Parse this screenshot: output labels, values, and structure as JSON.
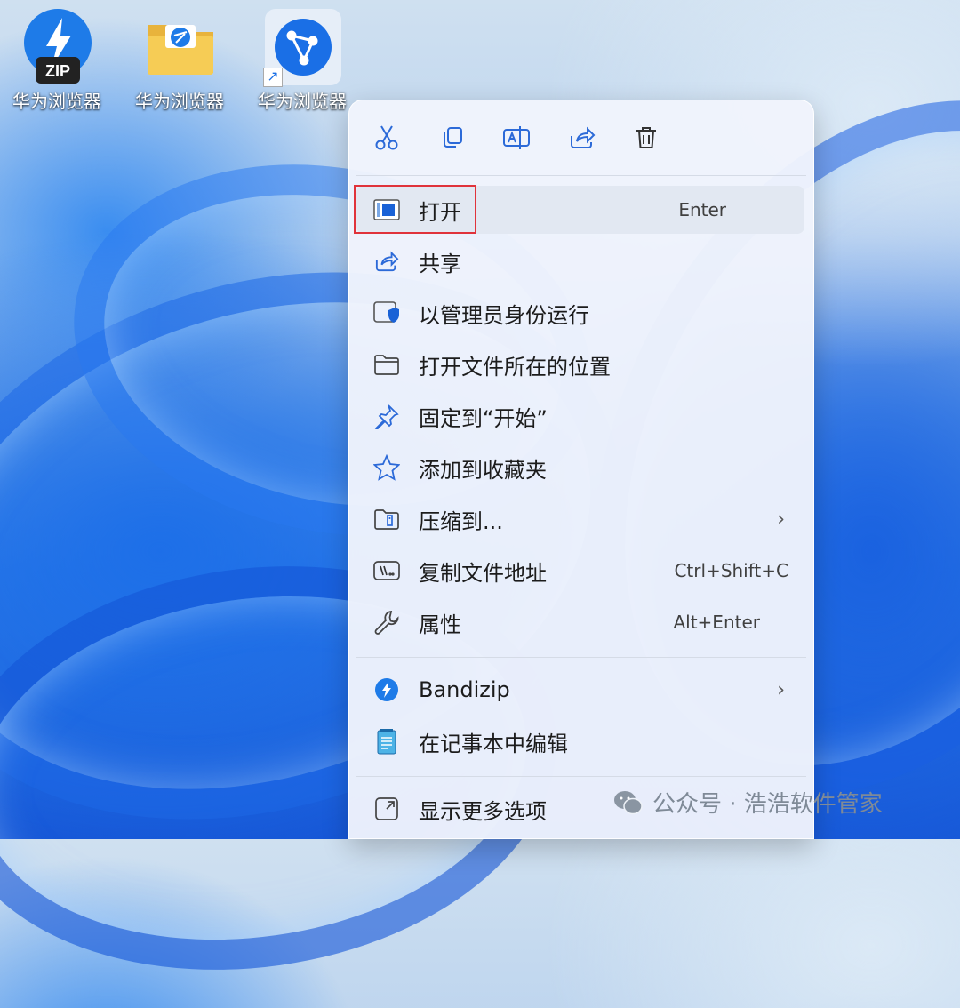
{
  "desktop": {
    "icons": [
      {
        "label": "华为浏览器",
        "badge": "ZIP"
      },
      {
        "label": "华为浏览器"
      },
      {
        "label": "华为浏览器"
      }
    ]
  },
  "menu": {
    "toolbar": [
      "cut",
      "copy",
      "rename",
      "share",
      "delete"
    ],
    "items": [
      {
        "label": "打开",
        "shortcut": "Enter"
      },
      {
        "label": "共享"
      },
      {
        "label": "以管理员身份运行"
      },
      {
        "label": "打开文件所在的位置"
      },
      {
        "label": "固定到“开始”"
      },
      {
        "label": "添加到收藏夹"
      },
      {
        "label": "压缩到..."
      },
      {
        "label": "复制文件地址",
        "shortcut": "Ctrl+Shift+C"
      },
      {
        "label": "属性",
        "shortcut": "Alt+Enter"
      },
      {
        "label": "Bandizip"
      },
      {
        "label": "在记事本中编辑"
      },
      {
        "label": "显示更多选项"
      }
    ]
  },
  "watermark": {
    "text": "公众号 · 浩浩软件管家"
  },
  "colors": {
    "accent": "#1a73e8",
    "highlight_border": "#e0333b"
  }
}
